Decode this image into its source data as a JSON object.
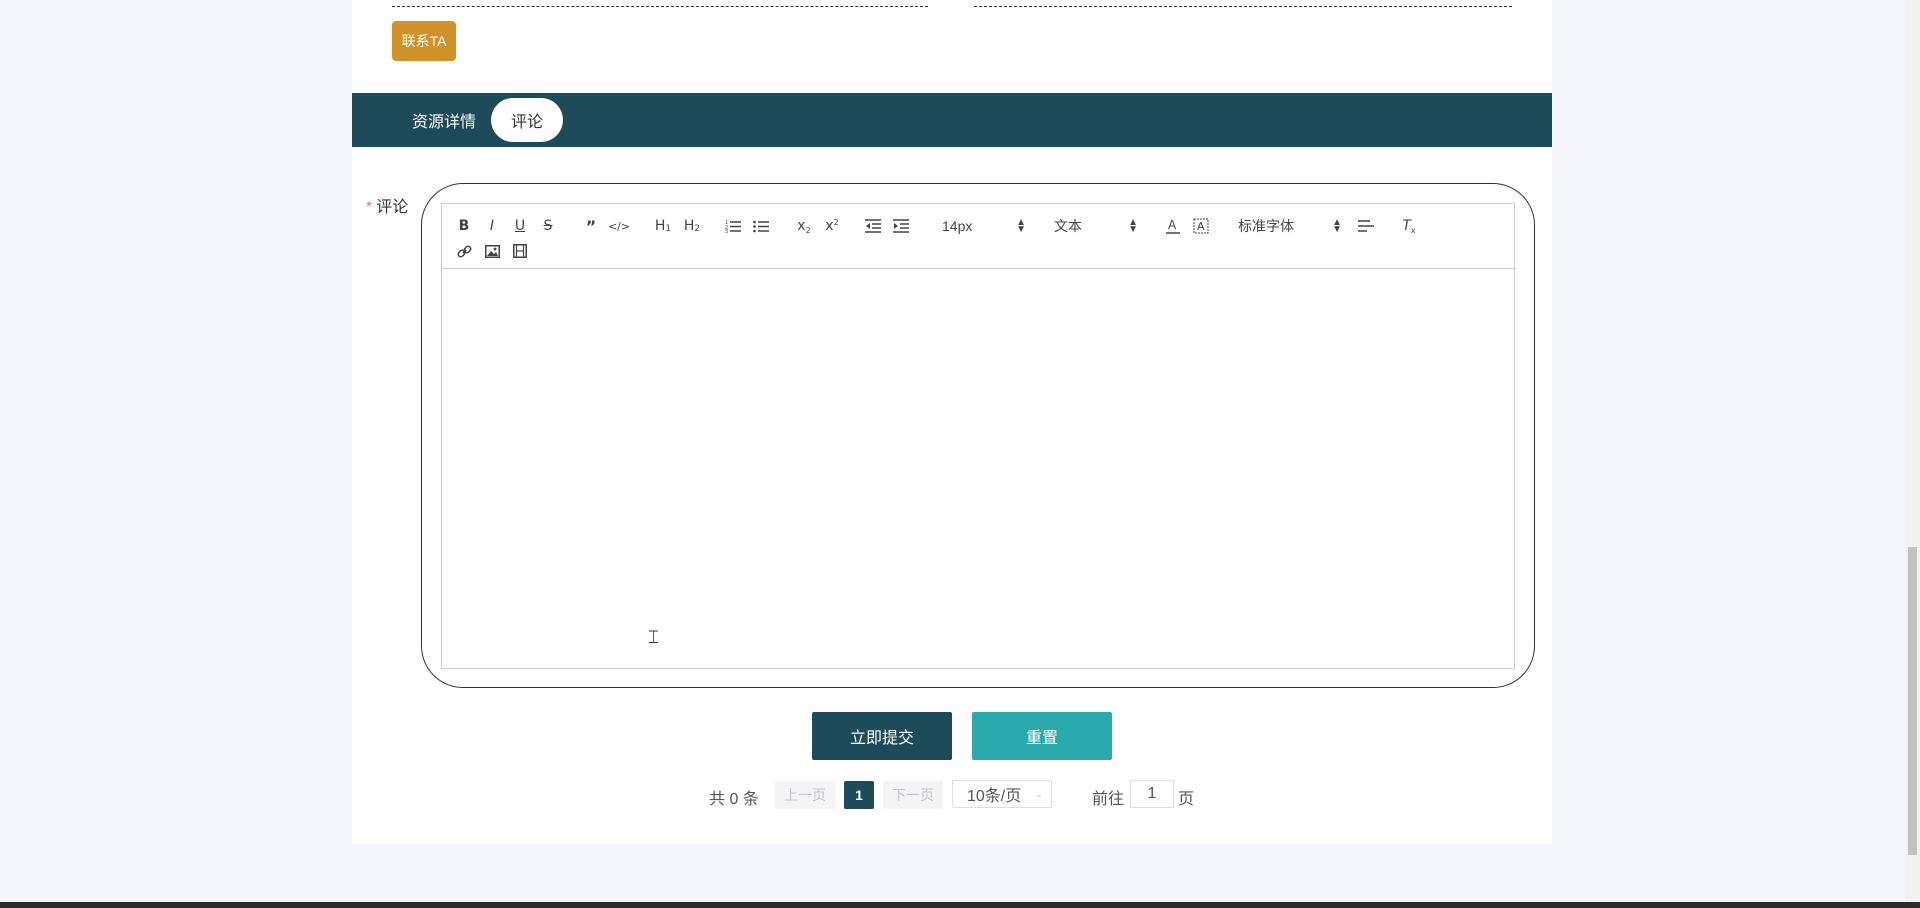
{
  "contact_button": "联系TA",
  "tabs": [
    {
      "label": "资源详情",
      "active": false
    },
    {
      "label": "评论",
      "active": true
    }
  ],
  "comment_field": {
    "required_mark": "*",
    "label": "评论"
  },
  "editor": {
    "toolbar_row1": [
      "bold",
      "italic",
      "underline",
      "strike",
      "blockquote",
      "code-block",
      "header-1",
      "header-2",
      "ordered-list",
      "bullet-list",
      "subscript",
      "superscript",
      "outdent",
      "indent"
    ],
    "font_size_value": "14px",
    "header_value": "文本",
    "font_family_value": "标准字体",
    "toolbar_row2": [
      "link",
      "image",
      "video"
    ]
  },
  "buttons": {
    "submit": "立即提交",
    "reset": "重置"
  },
  "pagination": {
    "total": "共 0 条",
    "prev": "上一页",
    "current": "1",
    "next": "下一页",
    "page_size": "10条/页",
    "goto_prefix": "前往",
    "goto_value": "1",
    "goto_suffix": "页"
  },
  "colors": {
    "tab_bar": "#1e4b5a",
    "contact_button": "#d1922a",
    "submit_button": "#1e4b5a",
    "reset_button": "#2aaaad",
    "required": "#f56c6c"
  }
}
